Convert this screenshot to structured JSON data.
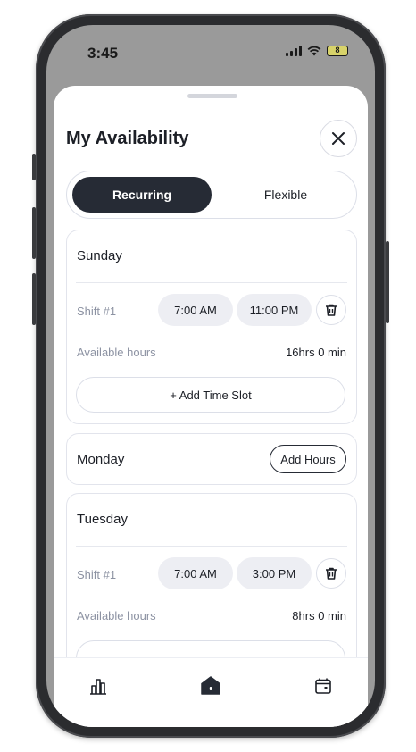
{
  "status_bar": {
    "time": "3:45",
    "battery": "8"
  },
  "sheet": {
    "title": "My Availability",
    "close_icon": "close-icon"
  },
  "segment": {
    "recurring": "Recurring",
    "flexible": "Flexible",
    "selected": "Recurring"
  },
  "days": {
    "sunday": {
      "name": "Sunday",
      "shift_label": "Shift #1",
      "start": "7:00 AM",
      "end": "11:00 PM",
      "available_label": "Available hours",
      "available_value": "16hrs 0 min",
      "add_slot": "+ Add Time Slot"
    },
    "monday": {
      "name": "Monday",
      "add_hours": "Add Hours"
    },
    "tuesday": {
      "name": "Tuesday",
      "shift_label": "Shift #1",
      "start": "7:00 AM",
      "end": "3:00 PM",
      "available_label": "Available hours",
      "available_value": "8hrs 0 min"
    }
  },
  "tabbar": {
    "icons": [
      "chart-icon",
      "home-icon",
      "calendar-icon"
    ]
  },
  "colors": {
    "accent_dark": "#262b35",
    "pill_bg": "#edeef3",
    "muted_text": "#8d93a3"
  }
}
